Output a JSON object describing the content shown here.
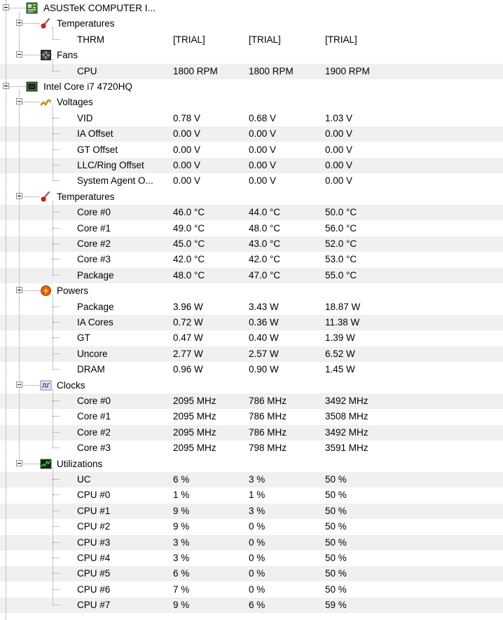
{
  "nodes": [
    {
      "type": "group",
      "level": 1,
      "icon": "motherboard-icon",
      "label": "ASUSTeK COMPUTER I..."
    },
    {
      "type": "group",
      "level": 2,
      "icon": "thermometer-icon",
      "label": "Temperatures"
    },
    {
      "type": "leaf",
      "label": "THRM",
      "v1": "[TRIAL]",
      "v2": "[TRIAL]",
      "v3": "[TRIAL]"
    },
    {
      "type": "group",
      "level": 2,
      "icon": "fan-icon",
      "label": "Fans"
    },
    {
      "type": "leaf",
      "label": "CPU",
      "v1": "1800 RPM",
      "v2": "1800 RPM",
      "v3": "1900 RPM"
    },
    {
      "type": "group",
      "level": 1,
      "icon": "chip-icon",
      "label": "Intel Core i7 4720HQ"
    },
    {
      "type": "group",
      "level": 2,
      "icon": "voltage-icon",
      "label": "Voltages"
    },
    {
      "type": "leaf",
      "label": "VID",
      "v1": "0.78 V",
      "v2": "0.68 V",
      "v3": "1.03 V"
    },
    {
      "type": "leaf",
      "label": "IA Offset",
      "v1": "0.00 V",
      "v2": "0.00 V",
      "v3": "0.00 V"
    },
    {
      "type": "leaf",
      "label": "GT Offset",
      "v1": "0.00 V",
      "v2": "0.00 V",
      "v3": "0.00 V"
    },
    {
      "type": "leaf",
      "label": "LLC/Ring Offset",
      "v1": "0.00 V",
      "v2": "0.00 V",
      "v3": "0.00 V"
    },
    {
      "type": "leaf",
      "label": "System Agent O...",
      "v1": "0.00 V",
      "v2": "0.00 V",
      "v3": "0.00 V"
    },
    {
      "type": "group",
      "level": 2,
      "icon": "thermometer-icon",
      "label": "Temperatures"
    },
    {
      "type": "leaf",
      "label": "Core #0",
      "v1": "46.0 °C",
      "v2": "44.0 °C",
      "v3": "50.0 °C"
    },
    {
      "type": "leaf",
      "label": "Core #1",
      "v1": "49.0 °C",
      "v2": "48.0 °C",
      "v3": "56.0 °C"
    },
    {
      "type": "leaf",
      "label": "Core #2",
      "v1": "45.0 °C",
      "v2": "43.0 °C",
      "v3": "52.0 °C"
    },
    {
      "type": "leaf",
      "label": "Core #3",
      "v1": "42.0 °C",
      "v2": "42.0 °C",
      "v3": "53.0 °C"
    },
    {
      "type": "leaf",
      "label": "Package",
      "v1": "48.0 °C",
      "v2": "47.0 °C",
      "v3": "55.0 °C"
    },
    {
      "type": "group",
      "level": 2,
      "icon": "power-icon",
      "label": "Powers"
    },
    {
      "type": "leaf",
      "label": "Package",
      "v1": "3.96 W",
      "v2": "3.43 W",
      "v3": "18.87 W"
    },
    {
      "type": "leaf",
      "label": "IA Cores",
      "v1": "0.72 W",
      "v2": "0.36 W",
      "v3": "11.38 W"
    },
    {
      "type": "leaf",
      "label": "GT",
      "v1": "0.47 W",
      "v2": "0.40 W",
      "v3": "1.39 W"
    },
    {
      "type": "leaf",
      "label": "Uncore",
      "v1": "2.77 W",
      "v2": "2.57 W",
      "v3": "6.52 W"
    },
    {
      "type": "leaf",
      "label": "DRAM",
      "v1": "0.96 W",
      "v2": "0.90 W",
      "v3": "1.45 W"
    },
    {
      "type": "group",
      "level": 2,
      "icon": "clock-icon",
      "label": "Clocks"
    },
    {
      "type": "leaf",
      "label": "Core #0",
      "v1": "2095 MHz",
      "v2": "786 MHz",
      "v3": "3492 MHz"
    },
    {
      "type": "leaf",
      "label": "Core #1",
      "v1": "2095 MHz",
      "v2": "786 MHz",
      "v3": "3508 MHz"
    },
    {
      "type": "leaf",
      "label": "Core #2",
      "v1": "2095 MHz",
      "v2": "786 MHz",
      "v3": "3492 MHz"
    },
    {
      "type": "leaf",
      "label": "Core #3",
      "v1": "2095 MHz",
      "v2": "798 MHz",
      "v3": "3591 MHz"
    },
    {
      "type": "group",
      "level": 2,
      "icon": "utilization-icon",
      "label": "Utilizations"
    },
    {
      "type": "leaf",
      "label": "UC",
      "v1": "6 %",
      "v2": "3 %",
      "v3": "50 %"
    },
    {
      "type": "leaf",
      "label": "CPU #0",
      "v1": "1 %",
      "v2": "1 %",
      "v3": "50 %"
    },
    {
      "type": "leaf",
      "label": "CPU #1",
      "v1": "9 %",
      "v2": "3 %",
      "v3": "50 %"
    },
    {
      "type": "leaf",
      "label": "CPU #2",
      "v1": "9 %",
      "v2": "0 %",
      "v3": "50 %"
    },
    {
      "type": "leaf",
      "label": "CPU #3",
      "v1": "3 %",
      "v2": "0 %",
      "v3": "50 %"
    },
    {
      "type": "leaf",
      "label": "CPU #4",
      "v1": "3 %",
      "v2": "0 %",
      "v3": "50 %"
    },
    {
      "type": "leaf",
      "label": "CPU #5",
      "v1": "6 %",
      "v2": "0 %",
      "v3": "50 %"
    },
    {
      "type": "leaf",
      "label": "CPU #6",
      "v1": "7 %",
      "v2": "0 %",
      "v3": "50 %"
    },
    {
      "type": "leaf",
      "label": "CPU #7",
      "v1": "9 %",
      "v2": "6 %",
      "v3": "59 %"
    }
  ],
  "colors": {
    "alt_row": "#f0f0f0",
    "tree_line": "#8c8c8c"
  }
}
